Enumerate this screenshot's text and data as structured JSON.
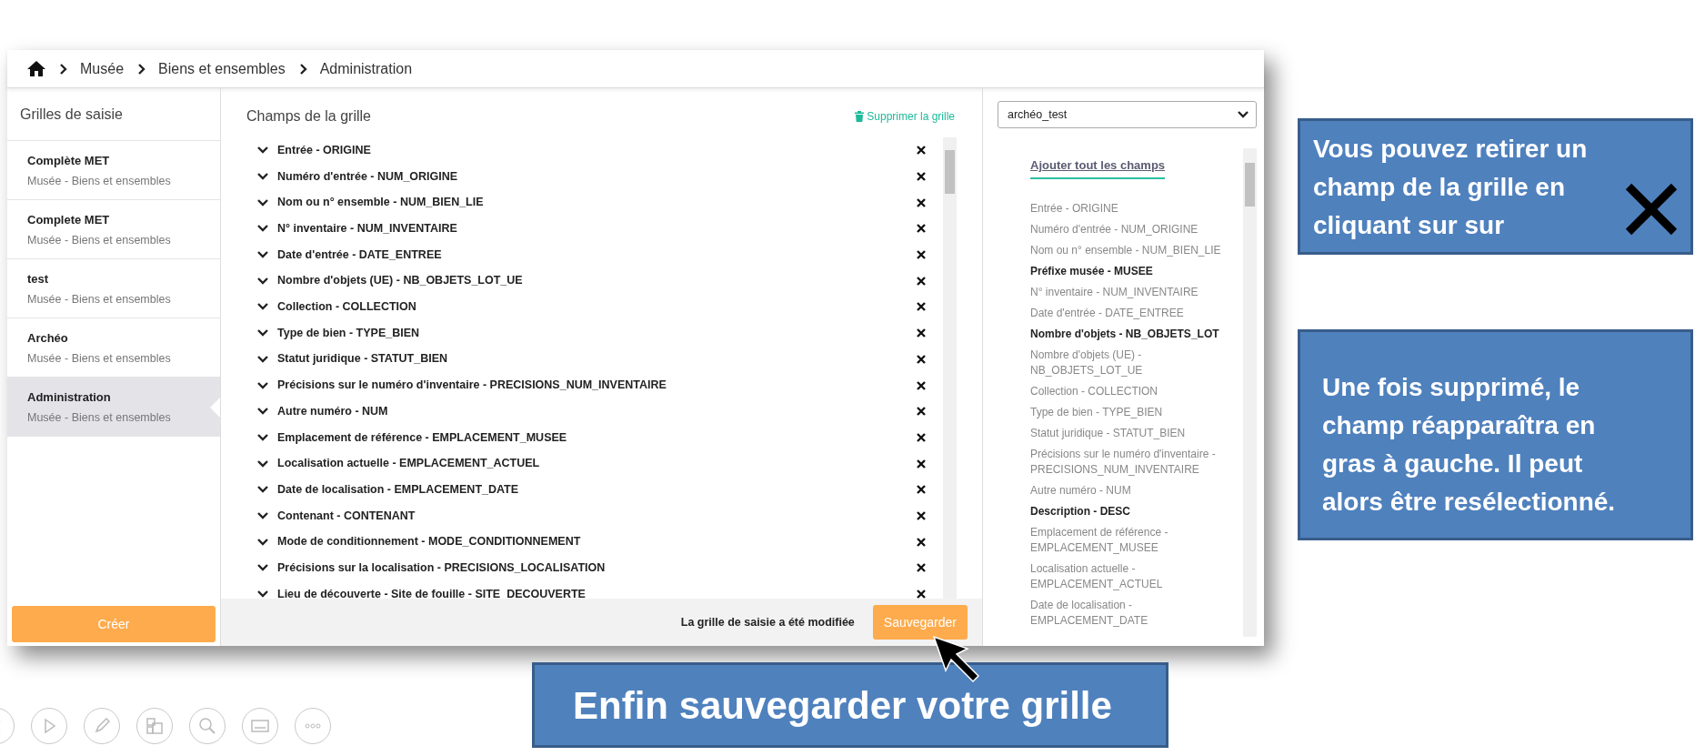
{
  "breadcrumb": [
    {
      "label": "Musée"
    },
    {
      "label": "Biens et ensembles"
    },
    {
      "label": "Administration"
    }
  ],
  "sidebar": {
    "title": "Grilles de saisie",
    "items": [
      {
        "name": "Complète MET",
        "subtitle": "Musée - Biens et ensembles",
        "selected": false
      },
      {
        "name": "Complete MET",
        "subtitle": "Musée - Biens et ensembles",
        "selected": false
      },
      {
        "name": "test",
        "subtitle": "Musée - Biens et ensembles",
        "selected": false
      },
      {
        "name": "Archéo",
        "subtitle": "Musée - Biens et ensembles",
        "selected": false
      },
      {
        "name": "Administration",
        "subtitle": "Musée - Biens et ensembles",
        "selected": true
      }
    ],
    "create_button": "Créer"
  },
  "grid_panel": {
    "title": "Champs de la grille",
    "delete_link": "Supprimer la grille",
    "fields": [
      "Entrée - ORIGINE",
      "Numéro d'entrée - NUM_ORIGINE",
      "Nom ou n° ensemble - NUM_BIEN_LIE",
      "N° inventaire - NUM_INVENTAIRE",
      "Date d'entrée - DATE_ENTREE",
      "Nombre d'objets (UE) - NB_OBJETS_LOT_UE",
      "Collection - COLLECTION",
      "Type de bien - TYPE_BIEN",
      "Statut juridique - STATUT_BIEN",
      "Précisions sur le numéro d'inventaire - PRECISIONS_NUM_INVENTAIRE",
      "Autre numéro - NUM",
      "Emplacement de référence - EMPLACEMENT_MUSEE",
      "Localisation actuelle - EMPLACEMENT_ACTUEL",
      "Date de localisation - EMPLACEMENT_DATE",
      "Contenant - CONTENANT",
      "Mode de conditionnement - MODE_CONDITIONNEMENT",
      "Précisions sur la localisation - PRECISIONS_LOCALISATION",
      "Lieu de découverte - Site de fouille - SITE_DECOUVERTE"
    ],
    "status": "La grille de saisie a été modifiée",
    "save_button": "Sauvegarder"
  },
  "fields_panel": {
    "select_value": "archéo_test",
    "add_all": "Ajouter tout les champs",
    "fields": [
      {
        "label": "Entrée - ORIGINE",
        "in_grid": true
      },
      {
        "label": "Numéro d'entrée - NUM_ORIGINE",
        "in_grid": true
      },
      {
        "label": "Nom ou n° ensemble - NUM_BIEN_LIE",
        "in_grid": true
      },
      {
        "label": "Préfixe musée - MUSEE",
        "in_grid": false
      },
      {
        "label": "N° inventaire - NUM_INVENTAIRE",
        "in_grid": true
      },
      {
        "label": "Date d'entrée - DATE_ENTREE",
        "in_grid": true
      },
      {
        "label": "Nombre d'objets - NB_OBJETS_LOT",
        "in_grid": false
      },
      {
        "label": "Nombre d'objets (UE) - NB_OBJETS_LOT_UE",
        "in_grid": true
      },
      {
        "label": "Collection - COLLECTION",
        "in_grid": true
      },
      {
        "label": "Type de bien - TYPE_BIEN",
        "in_grid": true
      },
      {
        "label": "Statut juridique - STATUT_BIEN",
        "in_grid": true
      },
      {
        "label": "Précisions sur le numéro d'inventaire - PRECISIONS_NUM_INVENTAIRE",
        "in_grid": true
      },
      {
        "label": "Autre numéro - NUM",
        "in_grid": true
      },
      {
        "label": "Description - DESC",
        "in_grid": false
      },
      {
        "label": "Emplacement de référence - EMPLACEMENT_MUSEE",
        "in_grid": true
      },
      {
        "label": "Localisation actuelle - EMPLACEMENT_ACTUEL",
        "in_grid": true
      },
      {
        "label": "Date de localisation - EMPLACEMENT_DATE",
        "in_grid": true
      }
    ]
  },
  "callouts": [
    {
      "text": "Vous pouvez retirer un champ de la grille en cliquant sur sur",
      "kind": "remove"
    },
    {
      "text": "Une fois supprimé, le champ réapparaîtra en gras à gauche. Il peut alors être resélectionné.",
      "kind": "info"
    },
    {
      "text": "Enfin sauvegarder votre grille",
      "kind": "save"
    }
  ]
}
